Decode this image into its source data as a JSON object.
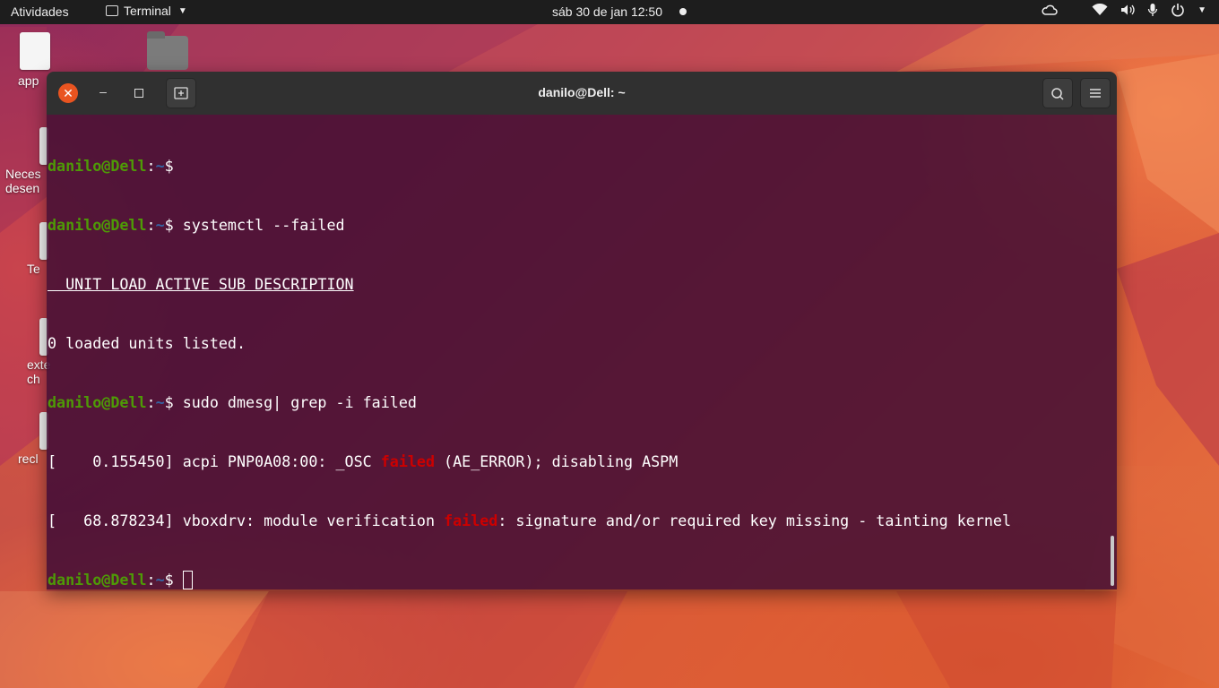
{
  "topbar": {
    "activities": "Atividades",
    "app_name": "Terminal",
    "clock": "sáb 30 de jan  12:50"
  },
  "desktop": {
    "icons": [
      {
        "label": "app"
      },
      {
        "label": "Neces\ndesen"
      },
      {
        "label": "Te"
      },
      {
        "label": "exte\nch"
      },
      {
        "label": "recl"
      }
    ]
  },
  "window": {
    "title": "danilo@Dell: ~"
  },
  "terminal": {
    "user_host": "danilo@Dell",
    "path": "~",
    "lines": {
      "l2_cmd": " systemctl --failed",
      "l3_header": "  UNIT LOAD ACTIVE SUB DESCRIPTION",
      "l4": "0 loaded units listed.",
      "l5_cmd": " sudo dmesg| grep -i failed",
      "l6_pre": "[    0.155450] acpi PNP0A08:00: _OSC ",
      "l6_fail": "failed",
      "l6_post": " (AE_ERROR); disabling ASPM",
      "l7_pre": "[   68.878234] vboxdrv: module verification ",
      "l7_fail": "failed",
      "l7_post": ": signature and/or required key missing - tainting kernel"
    }
  },
  "colors": {
    "accent": "#e95420",
    "prompt_user": "#4e9a06",
    "prompt_path": "#3465a4",
    "error": "#cc0000"
  }
}
